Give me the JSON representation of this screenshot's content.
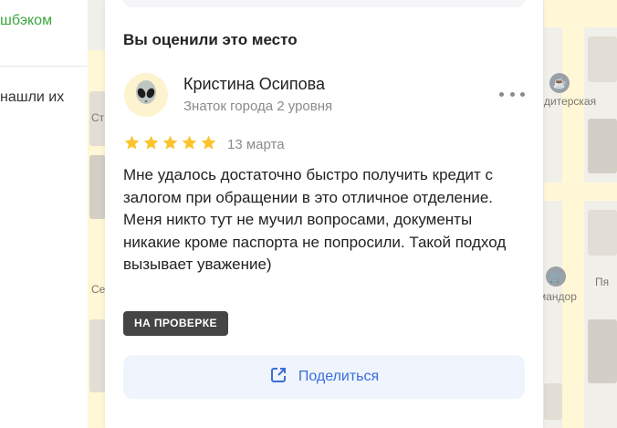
{
  "left_panel": {
    "link_text": "шбэком",
    "text": "нашли их"
  },
  "map": {
    "labels": [
      "Ст",
      "Се",
      "дитерская",
      "мандор",
      "Пя"
    ]
  },
  "review_card": {
    "section_title": "Вы оценили это место",
    "author": {
      "name": "Кристина Осипова",
      "level": "Знаток города 2 уровня",
      "avatar_icon": "alien-icon"
    },
    "rating": 5,
    "rating_max": 5,
    "date": "13 марта",
    "text": "Мне удалось достаточно быстро получить кредит с залогом при обращении в это отличное отделение. Меня никто тут не мучил вопросами, документы никакие кроме паспорта не попросили. Такой подход вызывает уважение)",
    "status_badge": "НА ПРОВЕРКЕ",
    "share_label": "Поделиться"
  },
  "colors": {
    "star": "#fcc32c",
    "share_text": "#3a6fd8",
    "share_bg": "#eff4fd",
    "badge_bg": "#454545",
    "left_link": "#3aa63c"
  }
}
